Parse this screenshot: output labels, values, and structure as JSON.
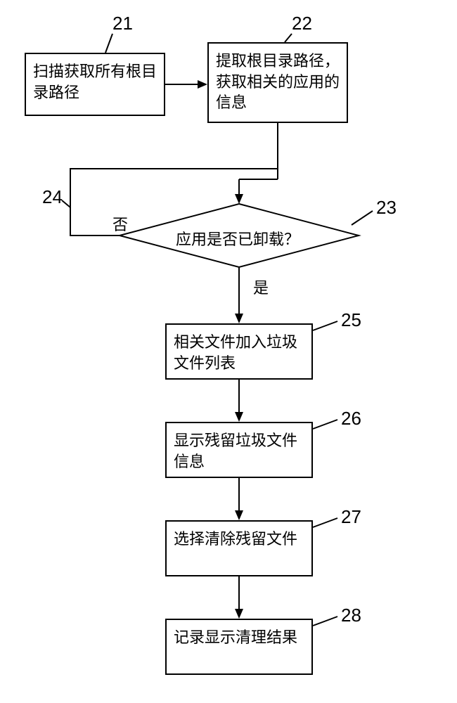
{
  "labels": {
    "n21": "21",
    "n22": "22",
    "n23": "23",
    "n24": "24",
    "n25": "25",
    "n26": "26",
    "n27": "27",
    "n28": "28"
  },
  "nodes": {
    "n21": "扫描获取所有根目录路径",
    "n22": "提取根目录路径，获取相关的应用的信息",
    "n23": "应用是否已卸载？",
    "n25": "相关文件加入垃圾文件列表",
    "n26": "显示残留垃圾文件信息",
    "n27": "选择清除残留文件",
    "n28": "记录显示清理结果"
  },
  "edges": {
    "yes": "是",
    "no": "否"
  },
  "chart_data": {
    "type": "flowchart",
    "nodes": [
      {
        "id": "21",
        "kind": "process",
        "text": "扫描获取所有根目录路径"
      },
      {
        "id": "22",
        "kind": "process",
        "text": "提取根目录路径，获取相关的应用的信息"
      },
      {
        "id": "23",
        "kind": "decision",
        "text": "应用是否已卸载？"
      },
      {
        "id": "24",
        "kind": "connector",
        "text": ""
      },
      {
        "id": "25",
        "kind": "process",
        "text": "相关文件加入垃圾文件列表"
      },
      {
        "id": "26",
        "kind": "process",
        "text": "显示残留垃圾文件信息"
      },
      {
        "id": "27",
        "kind": "process",
        "text": "选择清除残留文件"
      },
      {
        "id": "28",
        "kind": "process",
        "text": "记录显示清理结果"
      }
    ],
    "edges": [
      {
        "from": "21",
        "to": "22",
        "label": ""
      },
      {
        "from": "22",
        "to": "23",
        "label": ""
      },
      {
        "from": "23",
        "to": "25",
        "label": "是"
      },
      {
        "from": "23",
        "to": "24",
        "label": "否"
      },
      {
        "from": "24",
        "to": "22",
        "label": ""
      },
      {
        "from": "25",
        "to": "26",
        "label": ""
      },
      {
        "from": "26",
        "to": "27",
        "label": ""
      },
      {
        "from": "27",
        "to": "28",
        "label": ""
      }
    ]
  }
}
